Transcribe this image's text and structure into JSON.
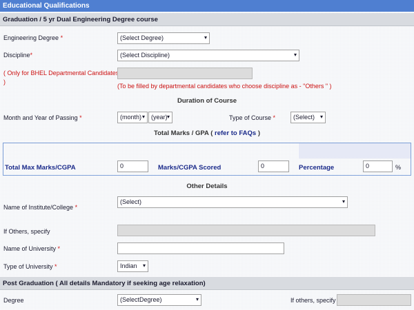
{
  "section_title": "Educational Qualifications",
  "graduation": {
    "header": "Graduation / 5 yr Dual Engineering Degree course",
    "engineering_degree": {
      "label": "Engineering Degree",
      "required": "*",
      "value": "(Select Degree)"
    },
    "discipline": {
      "label": "Discipline",
      "required": "*",
      "value": "(Select Discipline)"
    },
    "bhel": {
      "label_line1": "( Only for BHEL Departmental Candidates",
      "label_line2": ")",
      "note": "(To be filled by departmental candidates who choose discipline as - \"Others \" )"
    }
  },
  "duration": {
    "title": "Duration of Course",
    "month_year": {
      "label": "Month and Year of Passing",
      "required": "*",
      "month_value": "(month)",
      "year_value": "(year)"
    },
    "course_type": {
      "label": "Type of Course",
      "required": "*",
      "value": "(Select)"
    }
  },
  "marks": {
    "title": "Total Marks / GPA",
    "title_paren_open": "(",
    "link": "refer to FAQs",
    "title_paren_close": ")",
    "total_max_label": "Total Max Marks/CGPA",
    "total_max_value": "0",
    "scored_label": "Marks/CGPA Scored",
    "scored_value": "0",
    "percentage_label": "Percentage",
    "percentage_value": "0",
    "percent_sign": "%"
  },
  "other": {
    "title": "Other Details",
    "institute": {
      "label": "Name of Institute/College",
      "required": "*",
      "value": "(Select)"
    },
    "if_others": {
      "label": "If Others, specify"
    },
    "university": {
      "label": "Name of University",
      "required": "*"
    },
    "university_type": {
      "label": "Type of University",
      "required": "*",
      "value": "Indian"
    }
  },
  "post_graduation": {
    "header": "Post Graduation ( All details Mandatory if seeking age relaxation)",
    "degree": {
      "label": "Degree",
      "value": "(SelectDegree)"
    },
    "if_others": {
      "label": "If others, specify"
    }
  },
  "icons": {
    "dropdown": "▾"
  },
  "colors": {
    "header_blue": "#4f7fd1",
    "required_red": "#d01818",
    "label_blue": "#1a2a8a"
  }
}
